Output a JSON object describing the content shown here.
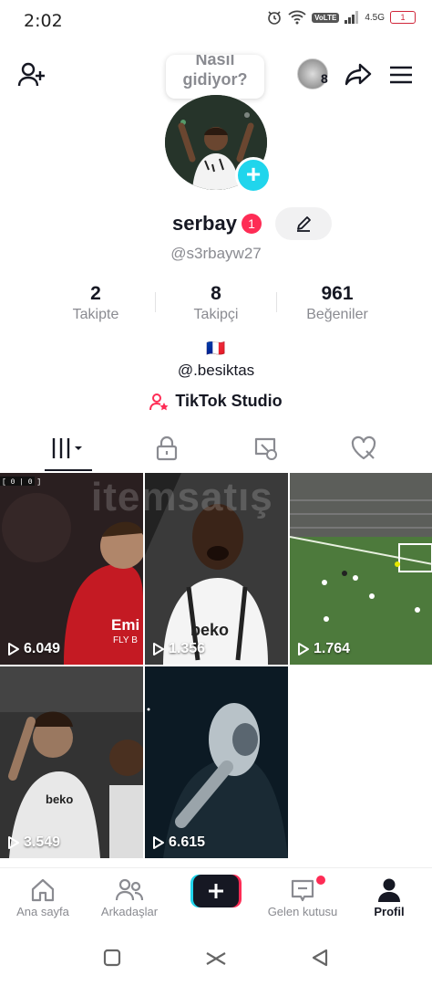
{
  "status": {
    "time": "2:02",
    "network": "4.5G",
    "volte": "VoLTE",
    "battery": "1"
  },
  "header": {
    "follower_avatar_count": "8"
  },
  "bubble": {
    "line1": "Nasıl",
    "line2": "gidiyor?"
  },
  "profile": {
    "username": "serbay",
    "notification_count": "1",
    "handle": "@s3rbayw27",
    "flag": "🇫🇷",
    "bio": "@.besiktas",
    "studio_label": "TikTok Studio"
  },
  "stats": [
    {
      "value": "2",
      "label": "Takipte"
    },
    {
      "value": "8",
      "label": "Takipçi"
    },
    {
      "value": "961",
      "label": "Beğeniler"
    }
  ],
  "tabs": [
    "videos-grid",
    "private",
    "reposts",
    "liked"
  ],
  "videos": [
    {
      "views": "6.049",
      "jersey_text": "Emi",
      "sponsor_text": "FLY B",
      "tag": "[ 0 | 0 ]"
    },
    {
      "views": "1.356",
      "sponsor_text": "beko"
    },
    {
      "views": "1.764"
    },
    {
      "views": "3.549",
      "sponsor_text": "beko"
    },
    {
      "views": "6.615"
    }
  ],
  "watermark": "itemsatış",
  "bottom_nav": [
    {
      "label": "Ana sayfa",
      "icon": "home-icon"
    },
    {
      "label": "Arkadaşlar",
      "icon": "friends-icon"
    },
    {
      "label": "",
      "icon": "create-icon"
    },
    {
      "label": "Gelen kutusu",
      "icon": "inbox-icon"
    },
    {
      "label": "Profil",
      "icon": "profile-icon"
    }
  ],
  "colors": {
    "accent": "#fe2c55",
    "cyan": "#20d5ec",
    "text": "#161823",
    "muted": "#8a8b91"
  }
}
